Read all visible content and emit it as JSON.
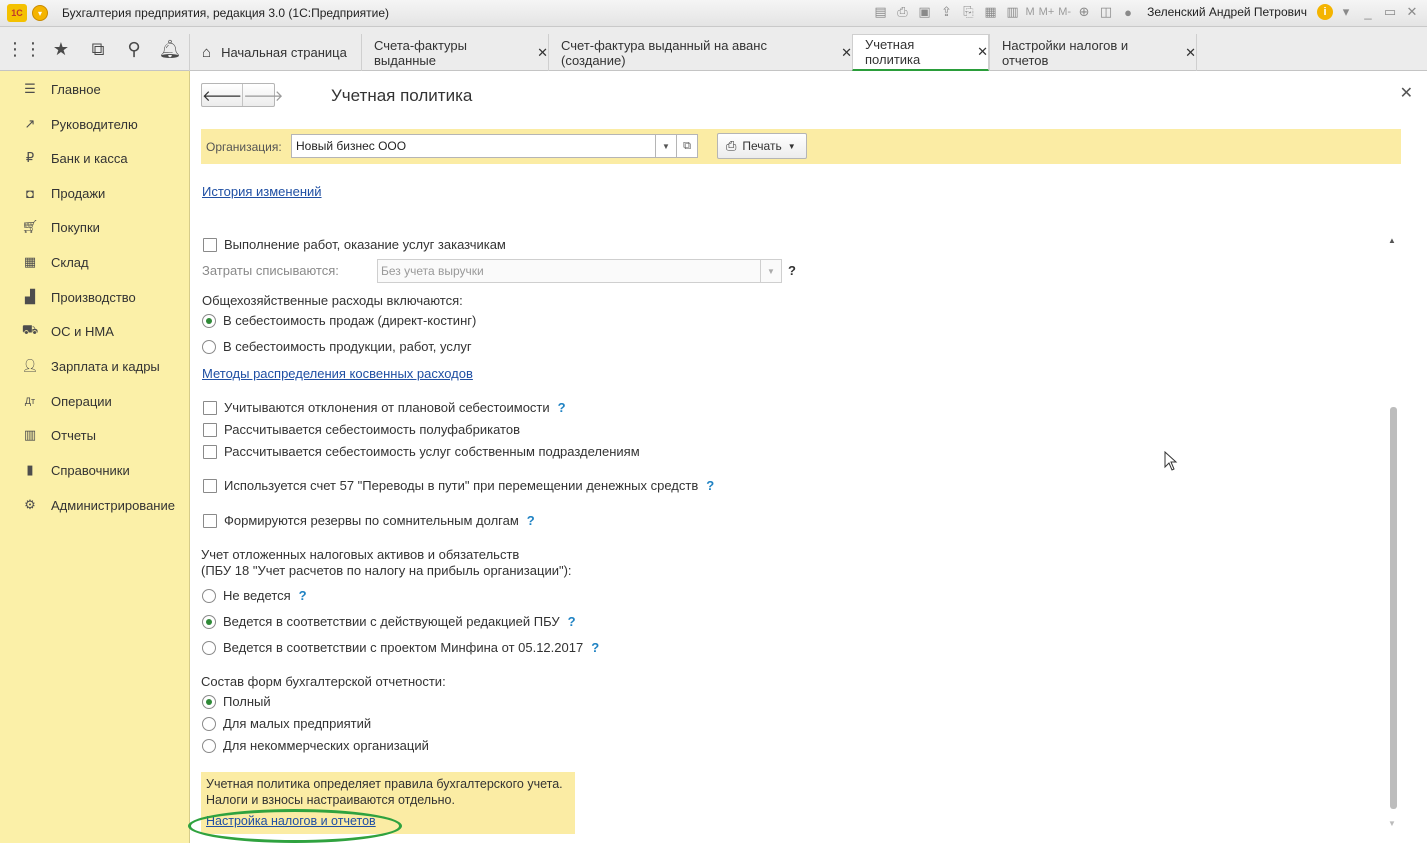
{
  "window": {
    "logo_text": "1C",
    "title": "Бухгалтерия предприятия, редакция 3.0  (1С:Предприятие)",
    "toolbar_icons": [
      "save-icon",
      "print-icon",
      "preview-icon",
      "export-icon",
      "attach-icon",
      "calculator-icon",
      "calendar-icon"
    ],
    "m_buttons": [
      "M",
      "M+",
      "M-"
    ],
    "user": "Зеленский Андрей Петрович",
    "info_label": "i",
    "window_controls": [
      "▾",
      "_",
      "▭",
      "✕"
    ]
  },
  "tabs": [
    {
      "label": "Начальная страница",
      "closable": false
    },
    {
      "label": "Счета-фактуры выданные",
      "closable": true
    },
    {
      "label": "Счет-фактура выданный на аванс (создание)",
      "closable": true
    },
    {
      "label": "Учетная политика",
      "closable": true,
      "active": true
    },
    {
      "label": "Настройки налогов и отчетов",
      "closable": true
    }
  ],
  "close_glyph": "✕",
  "sidebar": {
    "items": [
      {
        "label": "Главное",
        "icon": "menu-lines-icon"
      },
      {
        "label": "Руководителю",
        "icon": "trend-icon"
      },
      {
        "label": "Банк и касса",
        "icon": "ruble-coin-icon"
      },
      {
        "label": "Продажи",
        "icon": "shopping-bag-icon"
      },
      {
        "label": "Покупки",
        "icon": "cart-icon"
      },
      {
        "label": "Склад",
        "icon": "warehouse-icon"
      },
      {
        "label": "Производство",
        "icon": "factory-icon"
      },
      {
        "label": "ОС и НМА",
        "icon": "truck-icon"
      },
      {
        "label": "Зарплата и кадры",
        "icon": "person-icon"
      },
      {
        "label": "Операции",
        "icon": "dt-kt-icon"
      },
      {
        "label": "Отчеты",
        "icon": "bar-chart-icon"
      },
      {
        "label": "Справочники",
        "icon": "book-icon"
      },
      {
        "label": "Администрирование",
        "icon": "gear-icon"
      }
    ]
  },
  "form": {
    "title": "Учетная политика",
    "org_label": "Организация:",
    "org_value": "Новый бизнес ООО",
    "print_label": "Печать",
    "history_link": "История изменений",
    "works_checkbox": "Выполнение работ, оказание услуг заказчикам",
    "costs_label": "Затраты списываются:",
    "costs_value": "Без учета выручки",
    "overhead_label": "Общехозяйственные расходы включаются:",
    "overhead_opt1": "В себестоимость продаж (директ-костинг)",
    "overhead_opt2": "В  себестоимость продукции, работ, услуг",
    "methods_link": "Методы распределения косвенных расходов",
    "cb_deviation": "Учитываются отклонения от плановой себестоимости",
    "cb_semi": "Рассчитывается себестоимость полуфабрикатов",
    "cb_services": "Рассчитывается себестоимость услуг собственным подразделениям",
    "cb_account57": "Используется счет 57 \"Переводы в пути\" при перемещении денежных средств",
    "cb_reserves": "Формируются резервы по сомнительным долгам",
    "deferred_label1": "Учет отложенных налоговых активов и обязательств",
    "deferred_label2": "(ПБУ 18 \"Учет расчетов по налогу на прибыль организации\"):",
    "deferred_opt1": "Не ведется",
    "deferred_opt2": "Ведется в соответствии с действующей редакцией ПБУ",
    "deferred_opt3": "Ведется в соответствии с проектом Минфина от 05.12.2017",
    "forms_label": "Состав форм бухгалтерской отчетности:",
    "forms_opt1": "Полный",
    "forms_opt2": "Для малых предприятий",
    "forms_opt3": "Для некоммерческих организаций",
    "info_line1": "Учетная политика определяет правила бухгалтерского учета.",
    "info_line2": "Налоги и взносы настраиваются отдельно.",
    "tax_link": "Настройка налогов и отчетов",
    "help_glyph": "?"
  },
  "colors": {
    "sidebar_bg": "#fbf0a8",
    "yellow_panel": "#fbeca4",
    "link": "#1f4fa3",
    "active_tab_underline": "#2a9d3a",
    "highlight_ellipse": "#2fa23f"
  }
}
